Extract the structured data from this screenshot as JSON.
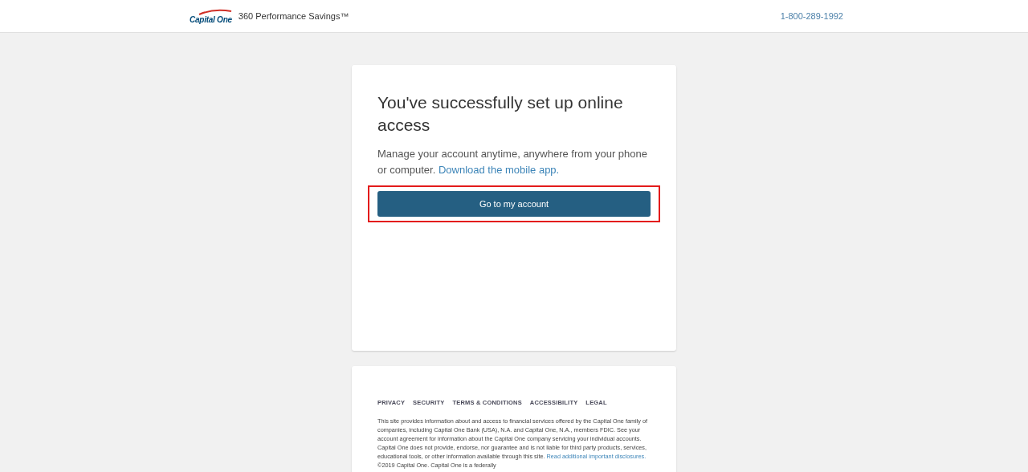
{
  "header": {
    "logo": "Capital One",
    "product": "360 Performance Savings™",
    "phone": "1-800-289-1992"
  },
  "card": {
    "title": "You've successfully set up online access",
    "message": "Manage your account anytime, anywhere from your phone or computer.",
    "link": "Download the mobile app.",
    "button": "Go to my account",
    "highlighted": true
  },
  "footer": {
    "links": [
      "PRIVACY",
      "SECURITY",
      "TERMS & CONDITIONS",
      "ACCESSIBILITY",
      "LEGAL"
    ],
    "disclaimer_before": "This site provides information about and access to financial services offered by the Capital One family of companies, including Capital One Bank (USA), N.A. and Capital One, N.A., members FDIC. See your account agreement for information about the Capital One company servicing your individual accounts. Capital One does not provide, endorse, nor guarantee and is not liable for third party products, services, educational tools, or other information available through this site.",
    "disclaimer_link": "Read additional important disclosures.",
    "disclaimer_after": "©2019 Capital One. Capital One is a federally"
  }
}
